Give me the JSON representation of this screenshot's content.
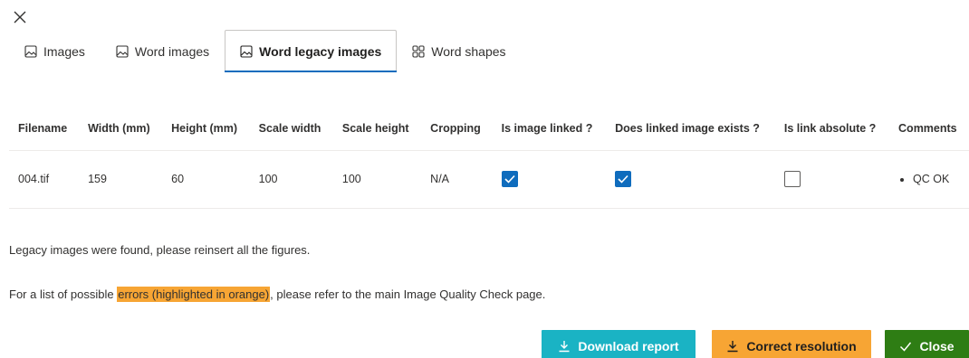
{
  "tabs": [
    {
      "label": "Images",
      "icon": "image-icon",
      "active": false
    },
    {
      "label": "Word images",
      "icon": "image-icon",
      "active": false
    },
    {
      "label": "Word legacy images",
      "icon": "image-icon",
      "active": true
    },
    {
      "label": "Word shapes",
      "icon": "shapes-grid-icon",
      "active": false
    }
  ],
  "table": {
    "headers": [
      "Filename",
      "Width (mm)",
      "Height (mm)",
      "Scale width",
      "Scale height",
      "Cropping",
      "Is image linked ?",
      "Does linked image exists ?",
      "Is link absolute ?",
      "Comments"
    ],
    "rows": [
      {
        "filename": "004.tif",
        "width": "159",
        "height": "60",
        "scale_width": "100",
        "scale_height": "100",
        "cropping": "N/A",
        "is_linked": true,
        "linked_exists": true,
        "is_absolute": false,
        "comments": [
          "QC OK"
        ]
      }
    ]
  },
  "messages": {
    "legacy": "Legacy images were found, please reinsert all the figures.",
    "errors_prefix": "For a list of possible ",
    "errors_highlight": "errors (highlighted in orange)",
    "errors_suffix": ", please refer to the main Image Quality Check page."
  },
  "buttons": {
    "download": "Download report",
    "correct": "Correct resolution",
    "close": "Close"
  },
  "colors": {
    "accent": "#0f6cbd",
    "download": "#1ab3c4",
    "correct": "#f7a534",
    "close": "#2e7d14",
    "highlight": "#f7a534"
  }
}
